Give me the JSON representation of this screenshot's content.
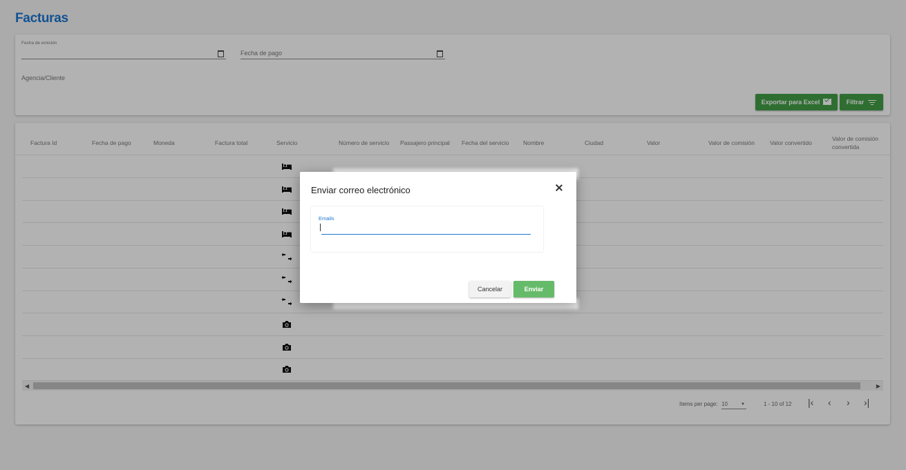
{
  "page": {
    "title": "Facturas"
  },
  "filters": {
    "fecha_emision_label": "Fecha de emisión",
    "fecha_pago_label": "Fecha de pago",
    "agencia_label": "Agencia/Cliente",
    "export_label": "Exportar para Excel",
    "filter_label": "Filtrar"
  },
  "table": {
    "columns": [
      "Factura Id",
      "Fecha de pago",
      "Moneda",
      "Factura total",
      "Servicio",
      "Número de servicio",
      "Passajero principal",
      "Fecha del servicio",
      "Nombre",
      "Ciudad",
      "Valor",
      "Valor de comisión",
      "Valor convertido",
      "Valor de comisión convertida"
    ],
    "rows": [
      {
        "service_icon": "bed-icon"
      },
      {
        "service_icon": "bed-icon"
      },
      {
        "service_icon": "bed-icon"
      },
      {
        "service_icon": "bed-icon"
      },
      {
        "service_icon": "transfer-icon"
      },
      {
        "service_icon": "transfer-icon"
      },
      {
        "service_icon": "transfer-icon"
      },
      {
        "service_icon": "camera-icon"
      },
      {
        "service_icon": "camera-icon"
      },
      {
        "service_icon": "camera-icon"
      }
    ]
  },
  "paginator": {
    "items_per_page_label": "Items per page:",
    "items_per_page_value": "10",
    "range_label": "1 - 10 of 12"
  },
  "dialog": {
    "title": "Enviar correo electrónico",
    "emails_label": "Emails",
    "emails_value": "",
    "cancel_label": "Cancelar",
    "send_label": "Enviar"
  },
  "colors": {
    "title_blue": "#1976d2",
    "export_green": "#43a047",
    "send_green": "#66bb6a"
  }
}
